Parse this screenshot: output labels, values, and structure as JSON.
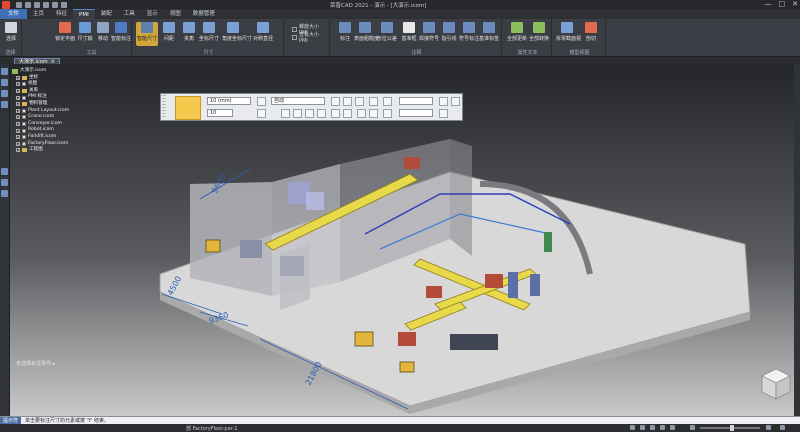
{
  "app": {
    "title": "荣晋CAD 2021 - 演示 - [大演示.icom]",
    "window_controls": [
      "—",
      "□",
      "✕"
    ]
  },
  "tabs": [
    {
      "label": "文件",
      "active": false
    },
    {
      "label": "主页",
      "active": false
    },
    {
      "label": "特征",
      "active": false
    },
    {
      "label": "PMI",
      "active": true
    },
    {
      "label": "装配",
      "active": false
    },
    {
      "label": "工具",
      "active": false
    },
    {
      "label": "显示",
      "active": false
    },
    {
      "label": "视图",
      "active": false
    },
    {
      "label": "数据管理",
      "active": false
    }
  ],
  "ribbon": {
    "groups": [
      {
        "label": "选择",
        "buttons": [
          "选择"
        ]
      },
      {
        "label": "工具",
        "buttons": [
          "锁定平面",
          "尺寸输",
          "移动",
          "智能标注"
        ]
      },
      {
        "label": "尺寸",
        "buttons": [
          "智能尺寸",
          "间距",
          "夹角",
          "坐标尺寸",
          "角度坐标尺寸",
          "对称直径"
        ]
      },
      {
        "label": "",
        "small": [
          "螺旋大小 PMI",
          "查看大小 PMI"
        ]
      },
      {
        "label": "注释",
        "buttons": [
          "标注",
          "表面粗糙度",
          "形位公差",
          "基准框",
          "焊接符号",
          "指引线",
          "符号标注",
          "基准标签"
        ]
      },
      {
        "label": "属性文本",
        "buttons": [
          "全部更新",
          "全部转换"
        ]
      },
      {
        "label": "模型视图",
        "buttons": [
          "拆零截面视",
          "剖切"
        ]
      }
    ],
    "active_button": "智能尺寸"
  },
  "document_tab": {
    "label": "大演示.icom",
    "close": "×"
  },
  "tree": [
    {
      "label": "大演示.icom",
      "level": 0
    },
    {
      "label": "坐标",
      "level": 1
    },
    {
      "label": "视图",
      "level": 1
    },
    {
      "label": "关系",
      "level": 1
    },
    {
      "label": "PMI 标注",
      "level": 1
    },
    {
      "label": "物料管理",
      "level": 1
    },
    {
      "label": "Plant Layout.icom",
      "level": 1
    },
    {
      "label": "Crane.icom",
      "level": 1
    },
    {
      "label": "Conveyor.icom",
      "level": 1
    },
    {
      "label": "Robot.icom",
      "level": 1
    },
    {
      "label": "Forklift.icom",
      "level": 1
    },
    {
      "label": "FactoryFloor.icom",
      "level": 1
    },
    {
      "label": "工程图",
      "level": 1
    }
  ],
  "float_toolbar": {
    "font_value": "10 (mm)",
    "size_value": "10",
    "mode_value": "自动"
  },
  "dimensions": [
    "4500",
    "9360",
    "21800",
    "9600"
  ],
  "status_left": "未选择标注零件 ▸",
  "command": {
    "label": "提示符",
    "text": "单击要标注尺寸的元素或按 'Y' 结束。"
  },
  "part_status": "部 FactoryFloor.par:1",
  "colors": {
    "accent": "#3f6fb5",
    "active_button": "#d1a73a",
    "dimension": "#2a5db0"
  }
}
